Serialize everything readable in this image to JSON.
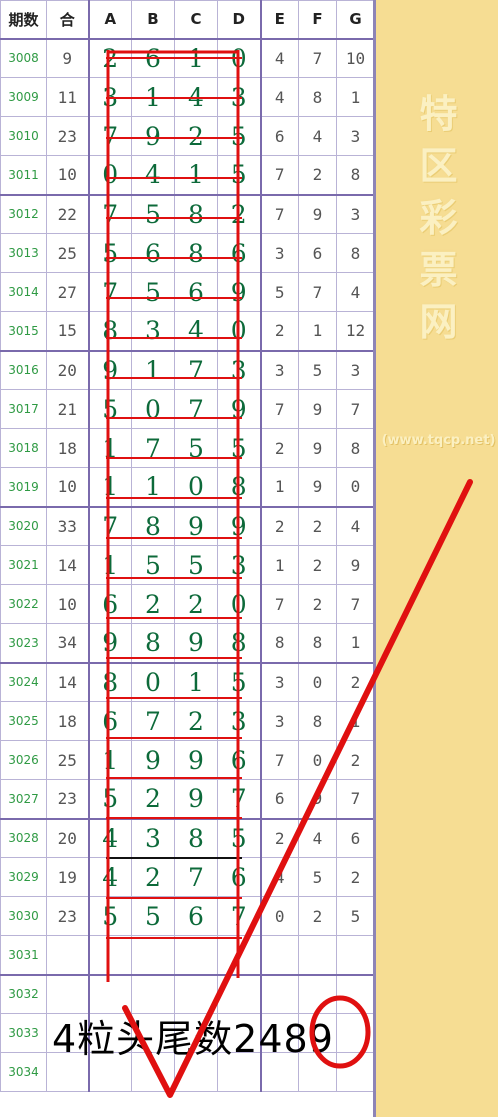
{
  "headers": {
    "issue": "期数",
    "sum": "合",
    "a": "A",
    "b": "B",
    "c": "C",
    "d": "D",
    "e": "E",
    "f": "F",
    "g": "G"
  },
  "rows": [
    {
      "issue": "3008",
      "sum": "9",
      "a": "2",
      "b": "6",
      "c": "1",
      "d": "0",
      "e": "4",
      "f": "7",
      "g": "10"
    },
    {
      "issue": "3009",
      "sum": "11",
      "a": "3",
      "b": "1",
      "c": "4",
      "d": "3",
      "e": "4",
      "f": "8",
      "g": "1"
    },
    {
      "issue": "3010",
      "sum": "23",
      "a": "7",
      "b": "9",
      "c": "2",
      "d": "5",
      "e": "6",
      "f": "4",
      "g": "3"
    },
    {
      "issue": "3011",
      "sum": "10",
      "a": "0",
      "b": "4",
      "c": "1",
      "d": "5",
      "e": "7",
      "f": "2",
      "g": "8"
    },
    {
      "issue": "3012",
      "sum": "22",
      "a": "7",
      "b": "5",
      "c": "8",
      "d": "2",
      "e": "7",
      "f": "9",
      "g": "3"
    },
    {
      "issue": "3013",
      "sum": "25",
      "a": "5",
      "b": "6",
      "c": "8",
      "d": "6",
      "e": "3",
      "f": "6",
      "g": "8"
    },
    {
      "issue": "3014",
      "sum": "27",
      "a": "7",
      "b": "5",
      "c": "6",
      "d": "9",
      "e": "5",
      "f": "7",
      "g": "4"
    },
    {
      "issue": "3015",
      "sum": "15",
      "a": "8",
      "b": "3",
      "c": "4",
      "d": "0",
      "e": "2",
      "f": "1",
      "g": "12"
    },
    {
      "issue": "3016",
      "sum": "20",
      "a": "9",
      "b": "1",
      "c": "7",
      "d": "3",
      "e": "3",
      "f": "5",
      "g": "3"
    },
    {
      "issue": "3017",
      "sum": "21",
      "a": "5",
      "b": "0",
      "c": "7",
      "d": "9",
      "e": "7",
      "f": "9",
      "g": "7"
    },
    {
      "issue": "3018",
      "sum": "18",
      "a": "1",
      "b": "7",
      "c": "5",
      "d": "5",
      "e": "2",
      "f": "9",
      "g": "8"
    },
    {
      "issue": "3019",
      "sum": "10",
      "a": "1",
      "b": "1",
      "c": "0",
      "d": "8",
      "e": "1",
      "f": "9",
      "g": "0"
    },
    {
      "issue": "3020",
      "sum": "33",
      "a": "7",
      "b": "8",
      "c": "9",
      "d": "9",
      "e": "2",
      "f": "2",
      "g": "4"
    },
    {
      "issue": "3021",
      "sum": "14",
      "a": "1",
      "b": "5",
      "c": "5",
      "d": "3",
      "e": "1",
      "f": "2",
      "g": "9"
    },
    {
      "issue": "3022",
      "sum": "10",
      "a": "6",
      "b": "2",
      "c": "2",
      "d": "0",
      "e": "7",
      "f": "2",
      "g": "7"
    },
    {
      "issue": "3023",
      "sum": "34",
      "a": "9",
      "b": "8",
      "c": "9",
      "d": "8",
      "e": "8",
      "f": "8",
      "g": "1"
    },
    {
      "issue": "3024",
      "sum": "14",
      "a": "8",
      "b": "0",
      "c": "1",
      "d": "5",
      "e": "3",
      "f": "0",
      "g": "2"
    },
    {
      "issue": "3025",
      "sum": "18",
      "a": "6",
      "b": "7",
      "c": "2",
      "d": "3",
      "e": "3",
      "f": "8",
      "g": "1"
    },
    {
      "issue": "3026",
      "sum": "25",
      "a": "1",
      "b": "9",
      "c": "9",
      "d": "6",
      "e": "7",
      "f": "0",
      "g": "2"
    },
    {
      "issue": "3027",
      "sum": "23",
      "a": "5",
      "b": "2",
      "c": "9",
      "d": "7",
      "e": "6",
      "f": "9",
      "g": "7"
    },
    {
      "issue": "3028",
      "sum": "20",
      "a": "4",
      "b": "3",
      "c": "8",
      "d": "5",
      "e": "2",
      "f": "4",
      "g": "6"
    },
    {
      "issue": "3029",
      "sum": "19",
      "a": "4",
      "b": "2",
      "c": "7",
      "d": "6",
      "e": "4",
      "f": "5",
      "g": "2"
    },
    {
      "issue": "3030",
      "sum": "23",
      "a": "5",
      "b": "5",
      "c": "6",
      "d": "7",
      "e": "0",
      "f": "2",
      "g": "5"
    },
    {
      "issue": "3031",
      "sum": "",
      "a": "",
      "b": "",
      "c": "",
      "d": "",
      "e": "",
      "f": "",
      "g": ""
    },
    {
      "issue": "3032",
      "sum": "",
      "a": "",
      "b": "",
      "c": "",
      "d": "",
      "e": "",
      "f": "",
      "g": ""
    },
    {
      "issue": "3033",
      "sum": "",
      "a": "",
      "b": "",
      "c": "",
      "d": "",
      "e": "",
      "f": "",
      "g": ""
    },
    {
      "issue": "3034",
      "sum": "",
      "a": "",
      "b": "",
      "c": "",
      "d": "",
      "e": "",
      "f": "",
      "g": ""
    }
  ],
  "note": "4粒头尾数2489",
  "watermark": {
    "chars": [
      "特",
      "区",
      "彩",
      "票",
      "网"
    ],
    "url": "(www.tqcp.net)"
  },
  "colors": {
    "issue_text": "#2f9a44",
    "digit_text": "#0d6a3a",
    "annotation": "#e01010",
    "side_panel": "#f6dd93"
  }
}
